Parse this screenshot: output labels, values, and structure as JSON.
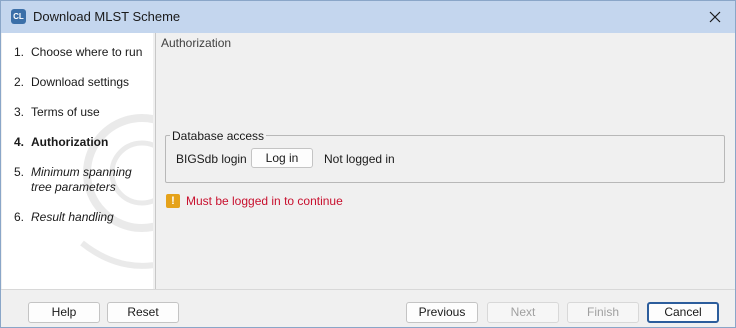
{
  "window": {
    "title": "Download MLST Scheme",
    "app_icon_text": "CL"
  },
  "sidebar": {
    "steps": [
      {
        "num": "1.",
        "label": "Choose where to run"
      },
      {
        "num": "2.",
        "label": "Download settings"
      },
      {
        "num": "3.",
        "label": "Terms of use"
      },
      {
        "num": "4.",
        "label": "Authorization",
        "active": true
      },
      {
        "num": "5.",
        "label": "Minimum spanning tree parameters",
        "italic": true
      },
      {
        "num": "6.",
        "label": "Result handling",
        "italic": true
      }
    ]
  },
  "content": {
    "title": "Authorization",
    "group": {
      "legend": "Database access",
      "field_label": "BIGSdb login",
      "login_button": "Log in",
      "status": "Not logged in"
    },
    "warning": {
      "icon": "warning-icon",
      "text": "Must be logged in to continue",
      "color": "#c8102e"
    }
  },
  "footer": {
    "help": "Help",
    "reset": "Reset",
    "previous": "Previous",
    "next": "Next",
    "finish": "Finish",
    "cancel": "Cancel"
  }
}
